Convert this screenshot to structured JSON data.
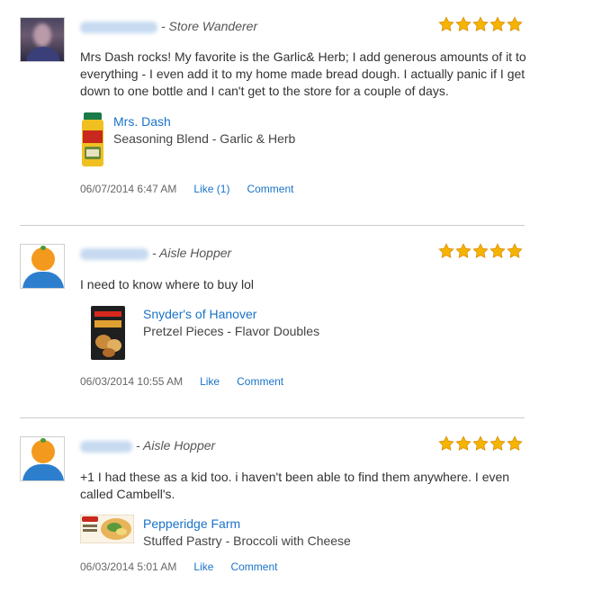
{
  "reviews": [
    {
      "user_title": "- Store Wanderer",
      "rating": 5,
      "text": "Mrs Dash rocks! My favorite is the Garlic& Herb; I add generous amounts of it to everything - I even add it to my home made bread dough. I actually panic if I get down to one bottle and I can't get to the store for a couple of days.",
      "product": {
        "brand": "Mrs. Dash",
        "description": "Seasoning Blend - Garlic & Herb"
      },
      "date": "06/07/2014 6:47 AM",
      "like_label": "Like (1)",
      "comment_label": "Comment"
    },
    {
      "user_title": "- Aisle Hopper",
      "rating": 5,
      "text": "I need to know where to buy lol",
      "product": {
        "brand": "Snyder's of Hanover",
        "description": "Pretzel Pieces - Flavor Doubles"
      },
      "date": "06/03/2014 10:55 AM",
      "like_label": "Like",
      "comment_label": "Comment"
    },
    {
      "user_title": "- Aisle Hopper",
      "rating": 5,
      "text": "+1 I had these as a kid too. i haven't been able to find them anywhere. I even called Cambell's.",
      "product": {
        "brand": "Pepperidge Farm",
        "description": "Stuffed Pastry - Broccoli with Cheese"
      },
      "date": "06/03/2014 5:01 AM",
      "like_label": "Like",
      "comment_label": "Comment"
    }
  ],
  "colors": {
    "link": "#1a73c8",
    "star": "#f5b400",
    "divider": "#cccccc"
  },
  "icons": {
    "rating": "star-icon",
    "default_avatar": "orange-person-icon"
  }
}
